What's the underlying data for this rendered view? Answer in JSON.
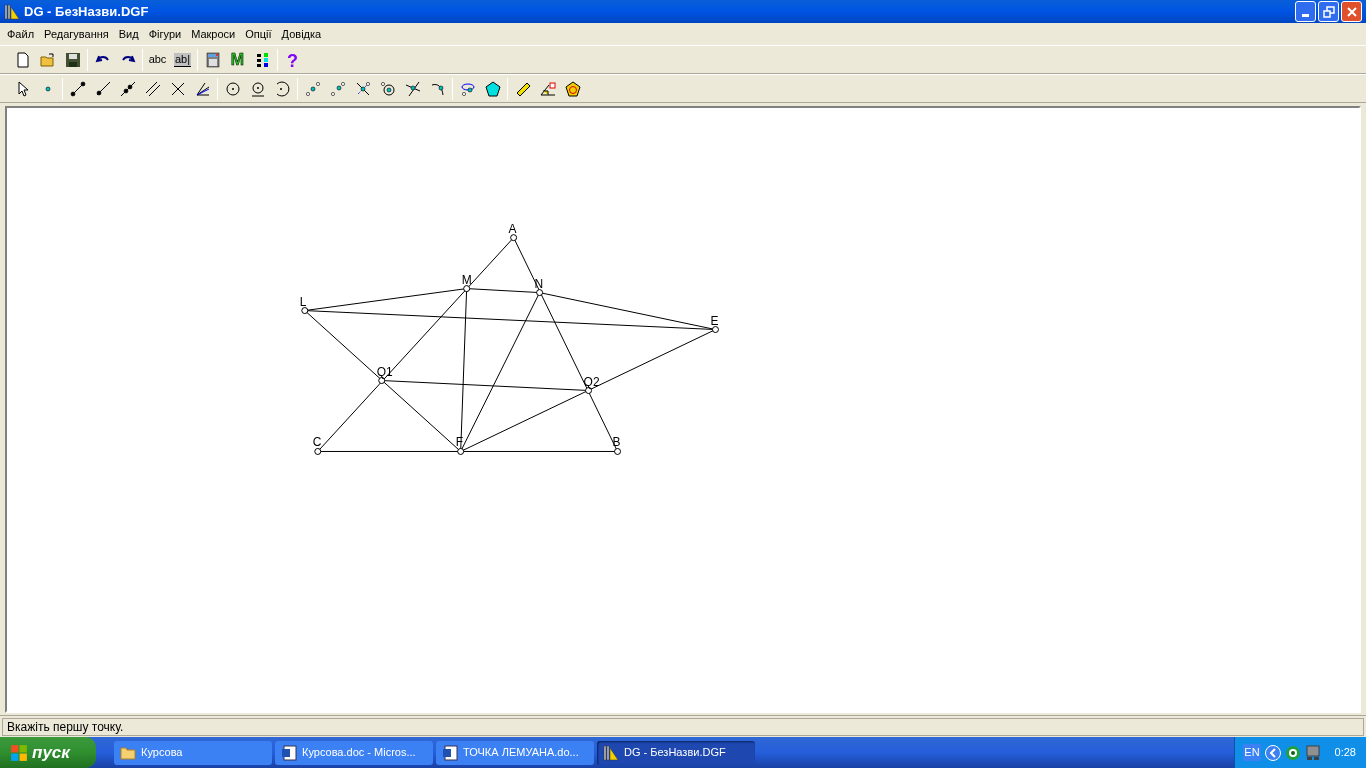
{
  "window": {
    "title": "DG - БезНазви.DGF"
  },
  "menu": [
    "Файл",
    "Редагування",
    "Вид",
    "Фігури",
    "Макроси",
    "Опції",
    "Довідка"
  ],
  "toolbar_texts": {
    "text_tool": "abc",
    "label_tool": "ab|",
    "macro_tool": "M",
    "help": "?"
  },
  "canvas": {
    "points": [
      {
        "label": "A"
      },
      {
        "label": "M"
      },
      {
        "label": "N"
      },
      {
        "label": "L"
      },
      {
        "label": "E"
      },
      {
        "label": "Q1"
      },
      {
        "label": "Q2"
      },
      {
        "label": "C"
      },
      {
        "label": "F"
      },
      {
        "label": "B"
      }
    ]
  },
  "status_bar": "Вкажіть першу точку.",
  "taskbar": {
    "start": "пуск",
    "tasks": [
      {
        "label": "Курсова",
        "kind": "folder",
        "selected": false
      },
      {
        "label": "Курсова.doc - Micros...",
        "kind": "doc",
        "selected": false
      },
      {
        "label": "ТОЧКА ЛЕМУАНА.do...",
        "kind": "doc",
        "selected": false
      },
      {
        "label": "DG - БезНазви.DGF",
        "kind": "app",
        "selected": true
      }
    ],
    "language": "EN",
    "time": "0:28"
  }
}
